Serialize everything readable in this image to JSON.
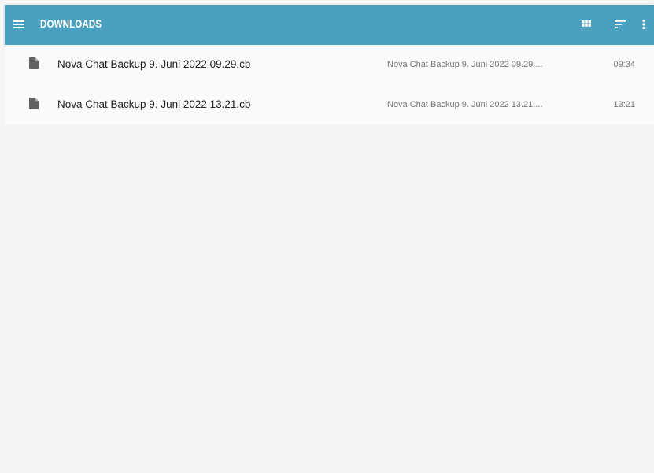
{
  "app": {
    "title": "DOWNLOADS",
    "toolbar_color": "#4b9fbf"
  },
  "toolbar": {
    "menu_icon": "menu-icon",
    "grid_icon": "grid-view-icon",
    "sort_icon": "sort-icon",
    "more_icon": "more-vert-icon"
  },
  "files": [
    {
      "name": "Nova Chat Backup 9. Juni 2022 09.29.cb",
      "summary": "Nova Chat Backup 9. Juni 2022 09.29....",
      "time": "09:34",
      "icon": "file-icon"
    },
    {
      "name": "Nova Chat Backup 9. Juni 2022 13.21.cb",
      "summary": "Nova Chat Backup 9. Juni 2022 13.21....",
      "time": "13:21",
      "icon": "file-icon"
    }
  ]
}
